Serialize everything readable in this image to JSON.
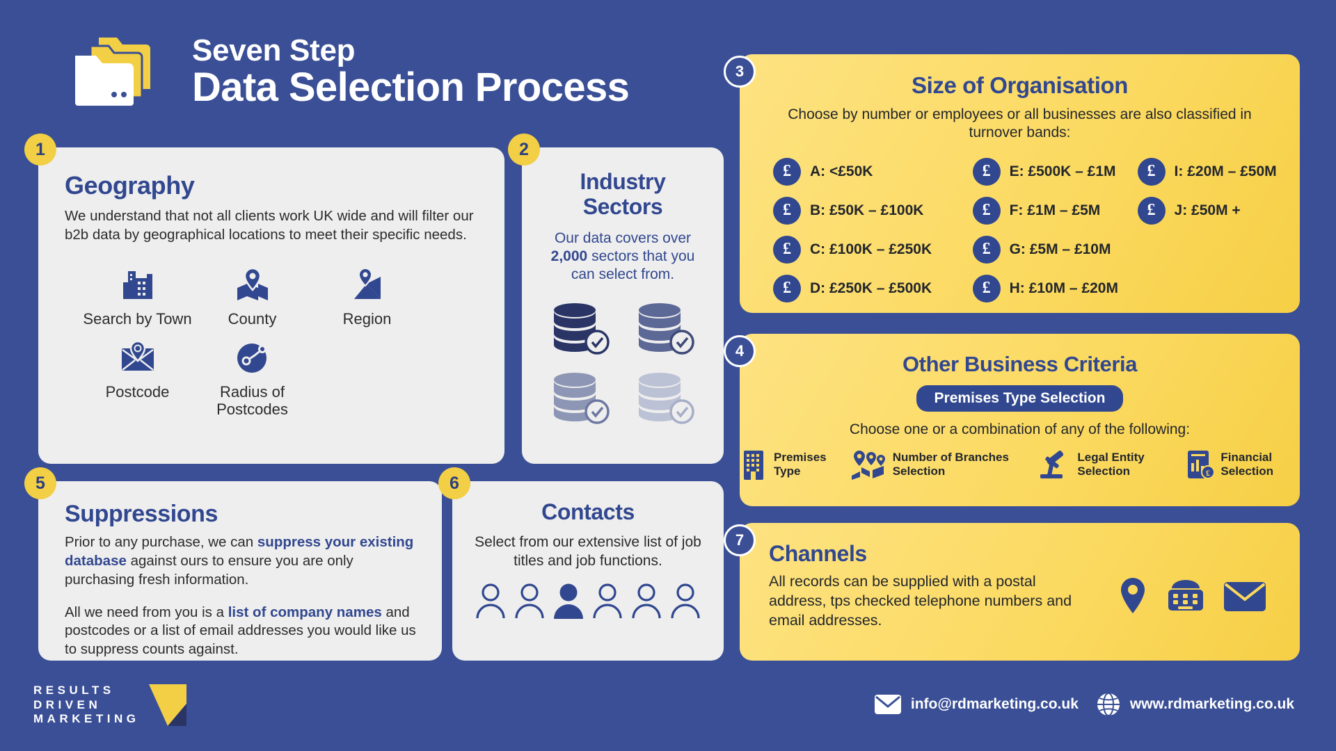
{
  "header": {
    "title_sub": "Seven Step",
    "title_main": "Data Selection Process",
    "logo_icon": "folders-icon"
  },
  "steps": {
    "one": "1",
    "two": "2",
    "three": "3",
    "four": "4",
    "five": "5",
    "six": "6",
    "seven": "7"
  },
  "geography": {
    "title": "Geography",
    "body": "We understand that not all clients work UK wide and will filter our b2b data by geographical locations to meet their specific needs.",
    "items": [
      {
        "label": "Search by Town",
        "icon": "buildings-icon"
      },
      {
        "label": "County",
        "icon": "map-pin-folded-icon"
      },
      {
        "label": "Region",
        "icon": "map-region-pin-icon"
      },
      {
        "label": "Postcode",
        "icon": "envelope-pin-icon"
      },
      {
        "label": "Radius of Postcodes",
        "icon": "radius-node-icon"
      }
    ]
  },
  "industry": {
    "title_line1": "Industry",
    "title_line2": "Sectors",
    "desc_pre": "Our data covers over ",
    "desc_bold": "2,000",
    "desc_post": " sectors that you can select from.",
    "db_icons": [
      "database-check-dark-icon",
      "database-check-mid-icon",
      "database-check-grey-icon",
      "database-check-light-icon"
    ]
  },
  "size": {
    "title": "Size of Organisation",
    "subtitle": "Choose by number or employees or all businesses are also classified in turnover bands:",
    "currency_icon": "pound-coin-icon",
    "col1": [
      {
        "label": "A: <£50K"
      },
      {
        "label": "B: £50K – £100K"
      },
      {
        "label": "C: £100K – £250K"
      },
      {
        "label": "D: £250K – £500K"
      }
    ],
    "col2": [
      {
        "label": "E: £500K – £1M"
      },
      {
        "label": "F: £1M – £5M"
      },
      {
        "label": "G: £5M – £10M"
      },
      {
        "label": "H: £10M – £20M"
      }
    ],
    "col3": [
      {
        "label": "I: £20M – £50M"
      },
      {
        "label": "J: £50M +"
      }
    ]
  },
  "criteria": {
    "title": "Other Business Criteria",
    "pill": "Premises Type Selection",
    "subtitle": "Choose one or a combination of any of the following:",
    "items": [
      {
        "label": "Premises Type",
        "icon": "office-building-icon"
      },
      {
        "label": "Number of Branches Selection",
        "icon": "branches-map-icon"
      },
      {
        "label": "Legal Entity Selection",
        "icon": "gavel-icon"
      },
      {
        "label": "Financial Selection",
        "icon": "financial-report-icon"
      }
    ]
  },
  "suppressions": {
    "title": "Suppressions",
    "p1_pre": "Prior to any purchase, we can ",
    "p1_hl": "suppress your existing database",
    "p1_post": " against ours to ensure you are only purchasing fresh information.",
    "p2_pre": "All we need from you is a ",
    "p2_hl": "list of company names",
    "p2_post": " and postcodes or a list of email addresses you would like us to suppress counts against."
  },
  "contacts": {
    "title": "Contacts",
    "desc": "Select from our extensive list of job titles and job functions.",
    "person_icon": "person-outline-icon",
    "person_count": 6,
    "highlighted_index": 2
  },
  "channels": {
    "title": "Channels",
    "desc": "All records can be supplied with a postal address, tps checked telephone numbers and email addresses.",
    "icons": [
      "location-pin-icon",
      "telephone-icon",
      "envelope-icon"
    ]
  },
  "footer": {
    "logo_line1": "RESULTS",
    "logo_line2": "DRIVEN",
    "logo_line3": "MARKETING",
    "logo_mark": "chevron-logo-mark",
    "email": "info@rdmarketing.co.uk",
    "email_icon": "envelope-icon",
    "website": "www.rdmarketing.co.uk",
    "website_icon": "globe-icon"
  },
  "colors": {
    "background_blue": "#3a4f96",
    "card_light": "#eeeeee",
    "card_yellow": "#fbd95f",
    "badge_yellow": "#f2cf44",
    "heading_blue": "#31478f"
  }
}
